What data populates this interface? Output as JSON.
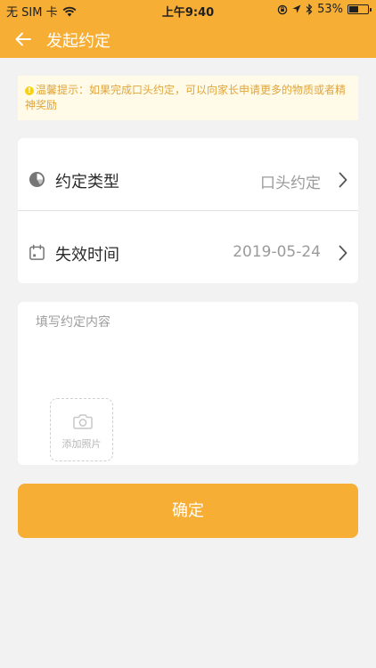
{
  "status_bar": {
    "carrier": "无 SIM 卡",
    "time": "上午9:40",
    "battery": "53%",
    "battery_level": 0.53
  },
  "nav": {
    "title": "发起约定"
  },
  "tip": {
    "text": "温馨提示：如果完成口头约定，可以向家长申请更多的物质或者精神奖励"
  },
  "form": {
    "type_label": "约定类型",
    "type_value": "口头约定",
    "expire_label": "失效时间",
    "expire_value": "2019-05-24"
  },
  "content": {
    "placeholder": "填写约定内容",
    "add_photo_label": "添加照片"
  },
  "confirm_label": "确定",
  "colors": {
    "accent": "#f6ae35",
    "tip_background": "#fffbe8",
    "tip_text": "#e1a53a"
  }
}
